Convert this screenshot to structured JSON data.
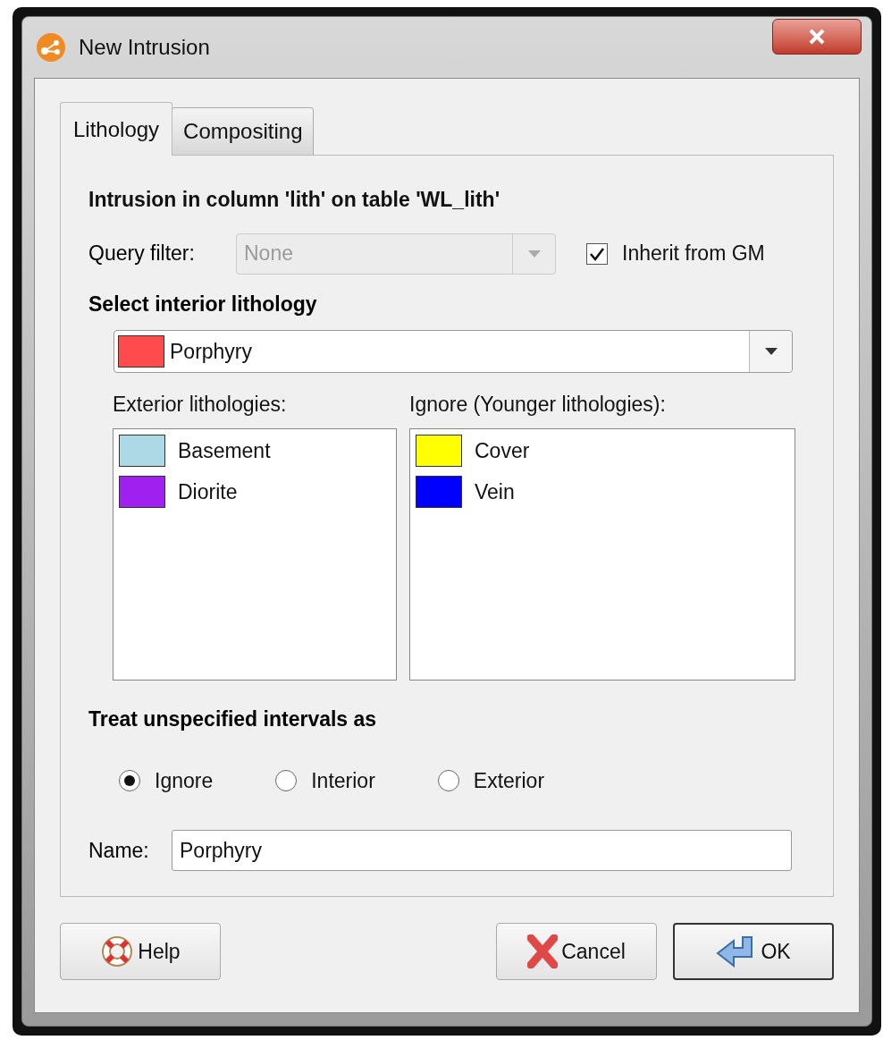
{
  "window": {
    "title": "New Intrusion"
  },
  "tabs": [
    {
      "label": "Lithology",
      "selected": true
    },
    {
      "label": "Compositing",
      "selected": false
    }
  ],
  "heading": "Intrusion in column 'lith' on table 'WL_lith'",
  "query_filter": {
    "label": "Query filter:",
    "value": "None",
    "disabled": true
  },
  "inherit": {
    "label": "Inherit from GM",
    "checked": true
  },
  "interior": {
    "label": "Select interior lithology",
    "value": "Porphyry",
    "color": "#ff4b4b"
  },
  "exterior": {
    "label": "Exterior lithologies:",
    "items": [
      {
        "name": "Basement",
        "color": "#add8e6"
      },
      {
        "name": "Diorite",
        "color": "#a020f0"
      }
    ]
  },
  "ignore": {
    "label": "Ignore (Younger lithologies):",
    "items": [
      {
        "name": "Cover",
        "color": "#ffff00"
      },
      {
        "name": "Vein",
        "color": "#0000ff"
      }
    ]
  },
  "unspecified": {
    "label": "Treat unspecified intervals as",
    "options": [
      {
        "label": "Ignore",
        "selected": true
      },
      {
        "label": "Interior",
        "selected": false
      },
      {
        "label": "Exterior",
        "selected": false
      }
    ]
  },
  "name": {
    "label": "Name:",
    "value": "Porphyry"
  },
  "buttons": [
    {
      "kind": "help",
      "label": "Help"
    },
    {
      "kind": "cancel",
      "label": "Cancel"
    },
    {
      "kind": "ok",
      "label": "OK"
    }
  ]
}
